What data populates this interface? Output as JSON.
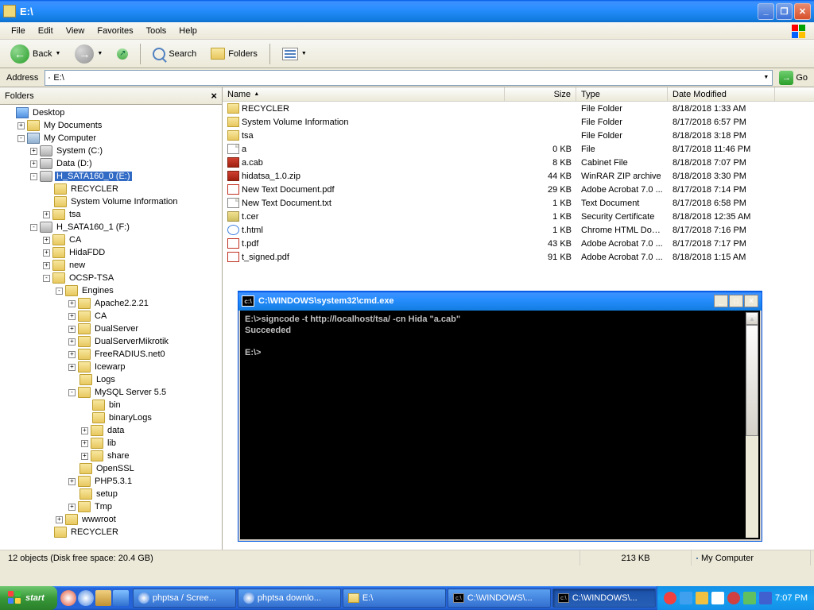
{
  "window": {
    "title": "E:\\"
  },
  "menu": [
    "File",
    "Edit",
    "View",
    "Favorites",
    "Tools",
    "Help"
  ],
  "toolbar": {
    "back": "Back",
    "search": "Search",
    "folders": "Folders"
  },
  "address": {
    "label": "Address",
    "value": "E:\\",
    "go": "Go"
  },
  "foldersPane": {
    "title": "Folders"
  },
  "tree": [
    {
      "indent": 0,
      "exp": "",
      "icon": "desktop",
      "label": "Desktop"
    },
    {
      "indent": 1,
      "exp": "+",
      "icon": "folder",
      "label": "My Documents"
    },
    {
      "indent": 1,
      "exp": "-",
      "icon": "computer",
      "label": "My Computer"
    },
    {
      "indent": 2,
      "exp": "+",
      "icon": "drive",
      "label": "System (C:)"
    },
    {
      "indent": 2,
      "exp": "+",
      "icon": "drive",
      "label": "Data (D:)"
    },
    {
      "indent": 2,
      "exp": "-",
      "icon": "drive",
      "label": "H_SATA160_0 (E:)",
      "selected": true
    },
    {
      "indent": 3,
      "exp": "",
      "icon": "folder",
      "label": "RECYCLER"
    },
    {
      "indent": 3,
      "exp": "",
      "icon": "folder",
      "label": "System Volume Information"
    },
    {
      "indent": 3,
      "exp": "+",
      "icon": "folder",
      "label": "tsa"
    },
    {
      "indent": 2,
      "exp": "-",
      "icon": "drive",
      "label": "H_SATA160_1 (F:)"
    },
    {
      "indent": 3,
      "exp": "+",
      "icon": "folder",
      "label": "CA"
    },
    {
      "indent": 3,
      "exp": "+",
      "icon": "folder",
      "label": "HidaFDD"
    },
    {
      "indent": 3,
      "exp": "+",
      "icon": "folder",
      "label": "new"
    },
    {
      "indent": 3,
      "exp": "-",
      "icon": "folder",
      "label": "OCSP-TSA"
    },
    {
      "indent": 4,
      "exp": "-",
      "icon": "folder",
      "label": "Engines"
    },
    {
      "indent": 5,
      "exp": "+",
      "icon": "folder",
      "label": "Apache2.2.21"
    },
    {
      "indent": 5,
      "exp": "+",
      "icon": "folder",
      "label": "CA"
    },
    {
      "indent": 5,
      "exp": "+",
      "icon": "folder",
      "label": "DualServer"
    },
    {
      "indent": 5,
      "exp": "+",
      "icon": "folder",
      "label": "DualServerMikrotik"
    },
    {
      "indent": 5,
      "exp": "+",
      "icon": "folder",
      "label": "FreeRADIUS.net0"
    },
    {
      "indent": 5,
      "exp": "+",
      "icon": "folder",
      "label": "Icewarp"
    },
    {
      "indent": 5,
      "exp": "",
      "icon": "folder",
      "label": "Logs"
    },
    {
      "indent": 5,
      "exp": "-",
      "icon": "folder",
      "label": "MySQL Server 5.5"
    },
    {
      "indent": 6,
      "exp": "",
      "icon": "folder",
      "label": "bin"
    },
    {
      "indent": 6,
      "exp": "",
      "icon": "folder",
      "label": "binaryLogs"
    },
    {
      "indent": 6,
      "exp": "+",
      "icon": "folder",
      "label": "data"
    },
    {
      "indent": 6,
      "exp": "+",
      "icon": "folder",
      "label": "lib"
    },
    {
      "indent": 6,
      "exp": "+",
      "icon": "folder",
      "label": "share"
    },
    {
      "indent": 5,
      "exp": "",
      "icon": "folder",
      "label": "OpenSSL"
    },
    {
      "indent": 5,
      "exp": "+",
      "icon": "folder",
      "label": "PHP5.3.1"
    },
    {
      "indent": 5,
      "exp": "",
      "icon": "folder",
      "label": "setup"
    },
    {
      "indent": 5,
      "exp": "+",
      "icon": "folder",
      "label": "Tmp"
    },
    {
      "indent": 4,
      "exp": "+",
      "icon": "folder",
      "label": "wwwroot"
    },
    {
      "indent": 3,
      "exp": "",
      "icon": "folder",
      "label": "RECYCLER"
    }
  ],
  "cols": {
    "name": "Name",
    "size": "Size",
    "type": "Type",
    "date": "Date Modified"
  },
  "files": [
    {
      "icon": "folder",
      "name": "RECYCLER",
      "size": "",
      "type": "File Folder",
      "date": "8/18/2018 1:33 AM"
    },
    {
      "icon": "folder",
      "name": "System Volume Information",
      "size": "",
      "type": "File Folder",
      "date": "8/17/2018 6:57 PM"
    },
    {
      "icon": "folder",
      "name": "tsa",
      "size": "",
      "type": "File Folder",
      "date": "8/18/2018 3:18 PM"
    },
    {
      "icon": "file",
      "name": "a",
      "size": "0 KB",
      "type": "File",
      "date": "8/17/2018 11:46 PM"
    },
    {
      "icon": "zip",
      "name": "a.cab",
      "size": "8 KB",
      "type": "Cabinet File",
      "date": "8/18/2018 7:07 PM"
    },
    {
      "icon": "zip",
      "name": "hidatsa_1.0.zip",
      "size": "44 KB",
      "type": "WinRAR ZIP archive",
      "date": "8/18/2018 3:30 PM"
    },
    {
      "icon": "pdf",
      "name": "New Text Document.pdf",
      "size": "29 KB",
      "type": "Adobe Acrobat 7.0 ...",
      "date": "8/17/2018 7:14 PM"
    },
    {
      "icon": "file",
      "name": "New Text Document.txt",
      "size": "1 KB",
      "type": "Text Document",
      "date": "8/17/2018 6:58 PM"
    },
    {
      "icon": "cer",
      "name": "t.cer",
      "size": "1 KB",
      "type": "Security Certificate",
      "date": "8/18/2018 12:35 AM"
    },
    {
      "icon": "html",
      "name": "t.html",
      "size": "1 KB",
      "type": "Chrome HTML Docu...",
      "date": "8/17/2018 7:16 PM"
    },
    {
      "icon": "pdf",
      "name": "t.pdf",
      "size": "43 KB",
      "type": "Adobe Acrobat 7.0 ...",
      "date": "8/17/2018 7:17 PM"
    },
    {
      "icon": "pdf",
      "name": "t_signed.pdf",
      "size": "91 KB",
      "type": "Adobe Acrobat 7.0 ...",
      "date": "8/18/2018 1:15 AM"
    }
  ],
  "cmd": {
    "title": "C:\\WINDOWS\\system32\\cmd.exe",
    "body": "E:\\>signcode -t http://localhost/tsa/ -cn Hida \"a.cab\"\nSucceeded\n\nE:\\>"
  },
  "status": {
    "left": "12 objects (Disk free space: 20.4 GB)",
    "mid": "213 KB",
    "right": "My Computer"
  },
  "taskbar": {
    "start": "start",
    "tasks": [
      {
        "icon": "html",
        "label": "phptsa / Scree..."
      },
      {
        "icon": "html",
        "label": "phptsa downlo..."
      },
      {
        "icon": "folder",
        "label": "E:\\"
      },
      {
        "icon": "cmd",
        "label": "C:\\WINDOWS\\..."
      },
      {
        "icon": "cmd",
        "label": "C:\\WINDOWS\\...",
        "active": true
      }
    ],
    "clock": "7:07 PM"
  }
}
